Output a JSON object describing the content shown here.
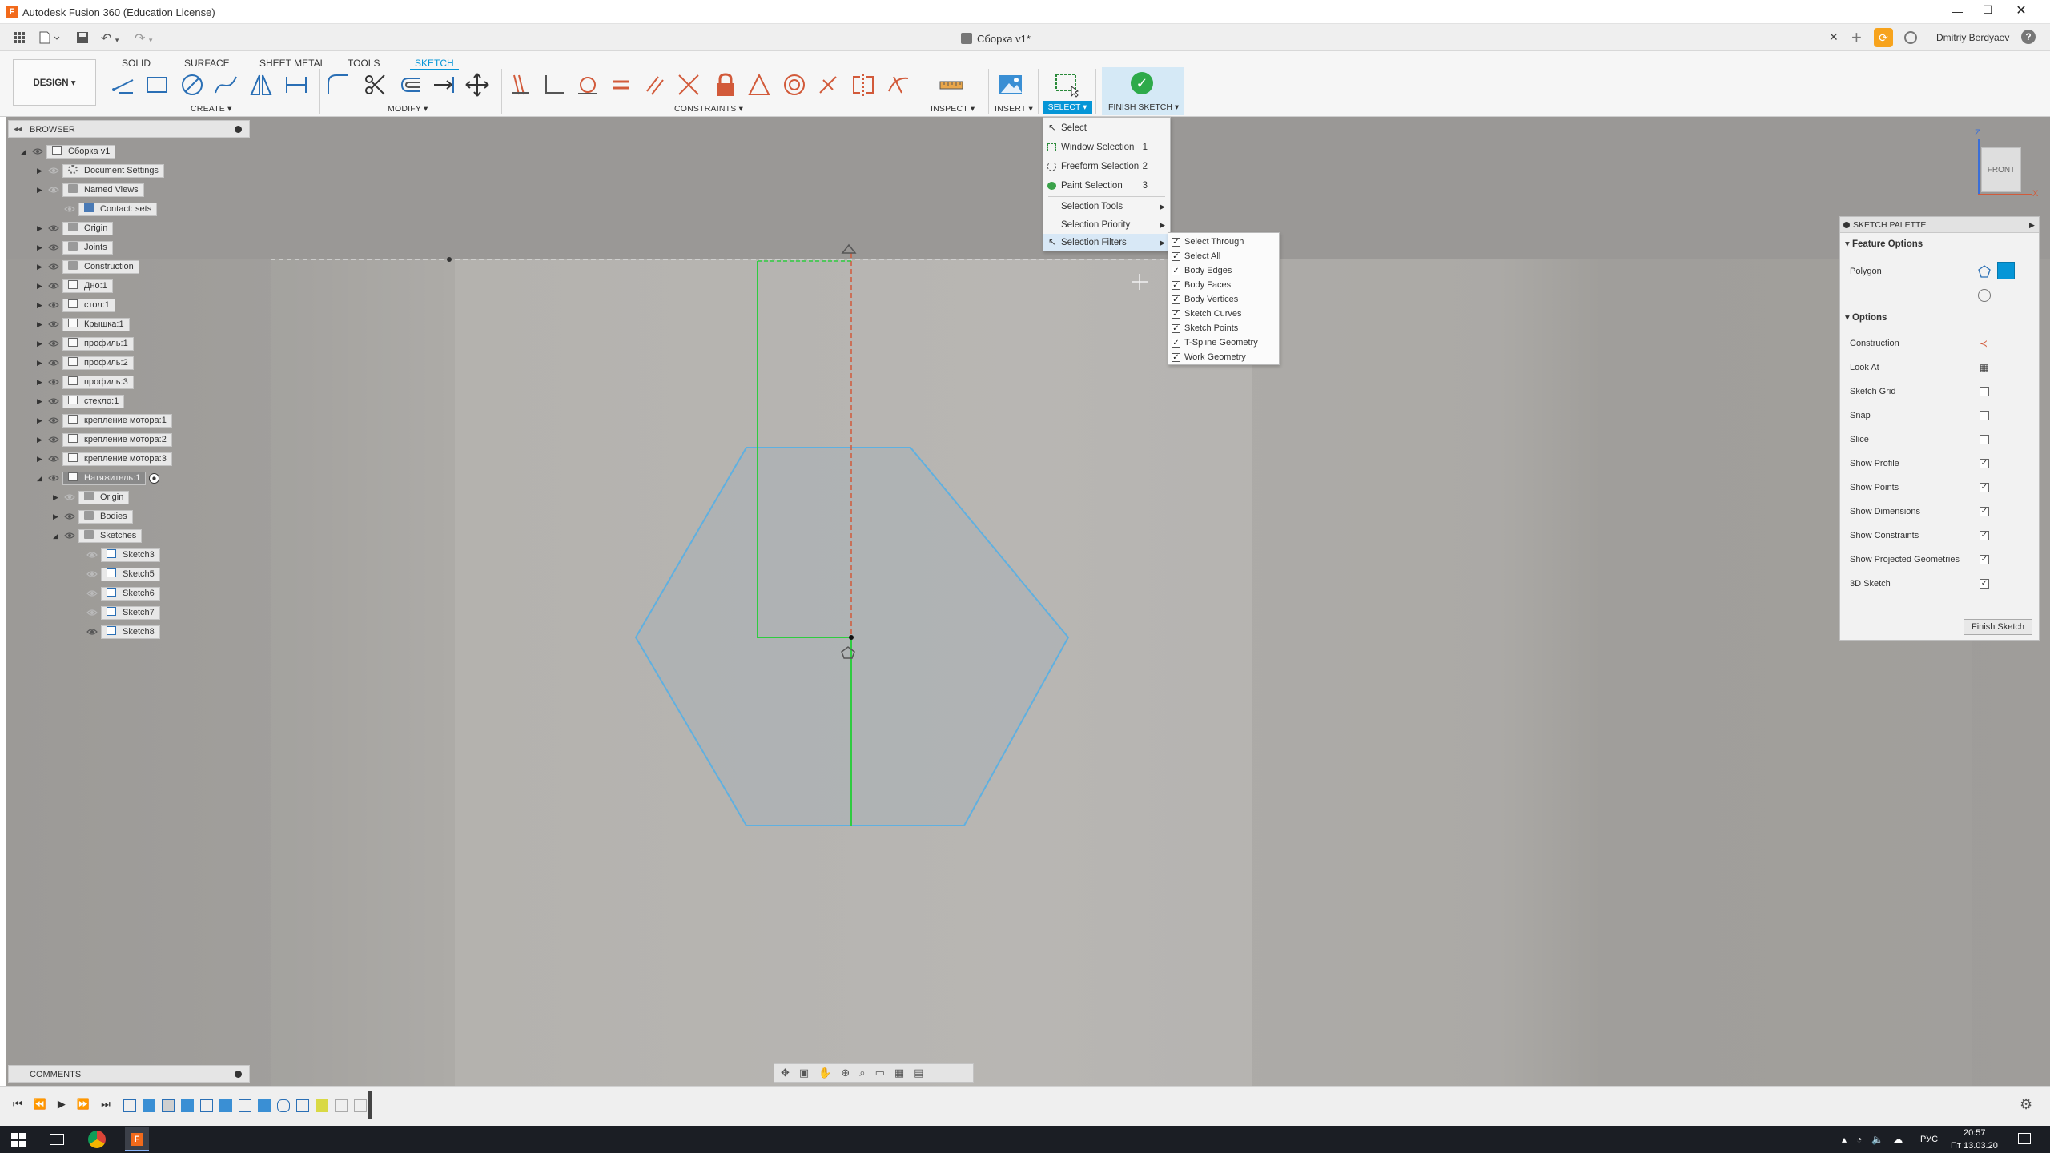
{
  "title_bar": {
    "app_title": "Autodesk Fusion 360 (Education License)"
  },
  "qat": {
    "doc_tab_title": "Сборка v1*",
    "user_name": "Dmitriy Berdyaev"
  },
  "ribbon": {
    "workspace": "DESIGN ▾",
    "tabs": [
      "SOLID",
      "SURFACE",
      "SHEET METAL",
      "TOOLS",
      "SKETCH"
    ],
    "active_tab": "SKETCH",
    "groups": {
      "create": "CREATE ▾",
      "modify": "MODIFY ▾",
      "constraints": "CONSTRAINTS ▾",
      "inspect": "INSPECT ▾",
      "insert": "INSERT ▾",
      "select": "SELECT ▾",
      "finish_sketch": "FINISH SKETCH ▾"
    }
  },
  "browser": {
    "header": "BROWSER",
    "items": [
      {
        "label": "Сборка v1"
      },
      {
        "label": "Document Settings"
      },
      {
        "label": "Named Views"
      },
      {
        "label": "Contact: sets"
      },
      {
        "label": "Origin"
      },
      {
        "label": "Joints"
      },
      {
        "label": "Construction"
      },
      {
        "label": "Дно:1"
      },
      {
        "label": "стол:1"
      },
      {
        "label": "Крышка:1"
      },
      {
        "label": "профиль:1"
      },
      {
        "label": "профиль:2"
      },
      {
        "label": "профиль:3"
      },
      {
        "label": "стекло:1"
      },
      {
        "label": "крепление мотора:1"
      },
      {
        "label": "крепление мотора:2"
      },
      {
        "label": "крепление мотора:3"
      },
      {
        "label": "Натяжитель:1"
      },
      {
        "label": "Origin"
      },
      {
        "label": "Bodies"
      },
      {
        "label": "Sketches"
      },
      {
        "label": "Sketch3"
      },
      {
        "label": "Sketch5"
      },
      {
        "label": "Sketch6"
      },
      {
        "label": "Sketch7"
      },
      {
        "label": "Sketch8"
      }
    ]
  },
  "select_menu": {
    "items": [
      {
        "label": "Select",
        "shortcut": ""
      },
      {
        "label": "Window Selection",
        "shortcut": "1"
      },
      {
        "label": "Freeform Selection",
        "shortcut": "2"
      },
      {
        "label": "Paint Selection",
        "shortcut": "3"
      },
      {
        "label": "Selection Tools",
        "shortcut": ""
      },
      {
        "label": "Selection Priority",
        "shortcut": ""
      },
      {
        "label": "Selection Filters",
        "shortcut": ""
      }
    ]
  },
  "filters_menu": {
    "items": [
      {
        "label": "Select Through",
        "checked": true
      },
      {
        "label": "Select All",
        "checked": true
      },
      {
        "label": "Body Edges",
        "checked": true
      },
      {
        "label": "Body Faces",
        "checked": true
      },
      {
        "label": "Body Vertices",
        "checked": true
      },
      {
        "label": "Sketch Curves",
        "checked": true
      },
      {
        "label": "Sketch Points",
        "checked": true
      },
      {
        "label": "T-Spline Geometry",
        "checked": true
      },
      {
        "label": "Work Geometry",
        "checked": true
      }
    ]
  },
  "viewcube": {
    "face_label": "FRONT",
    "axis_z": "Z",
    "axis_x": "X"
  },
  "palette": {
    "title": "SKETCH PALETTE",
    "feature_options": "Feature Options",
    "polygon_label": "Polygon",
    "options_header": "Options",
    "options": [
      {
        "label": "Construction",
        "checked": null
      },
      {
        "label": "Look At",
        "checked": null
      },
      {
        "label": "Sketch Grid",
        "checked": false
      },
      {
        "label": "Snap",
        "checked": false
      },
      {
        "label": "Slice",
        "checked": false
      },
      {
        "label": "Show Profile",
        "checked": true
      },
      {
        "label": "Show Points",
        "checked": true
      },
      {
        "label": "Show Dimensions",
        "checked": true
      },
      {
        "label": "Show Constraints",
        "checked": true
      },
      {
        "label": "Show Projected Geometries",
        "checked": true
      },
      {
        "label": "3D Sketch",
        "checked": true
      }
    ],
    "finish_button": "Finish Sketch"
  },
  "comments": {
    "label": "COMMENTS"
  },
  "taskbar": {
    "lang": "РУС",
    "time": "20:57",
    "date": "Пт 13.03.20"
  },
  "colors": {
    "accent": "#0696d7",
    "sketch_line": "#5fb0e0",
    "axis_green": "#2ecc40",
    "axis_red": "#d25a3a",
    "finish_green": "#2eaa4a"
  }
}
